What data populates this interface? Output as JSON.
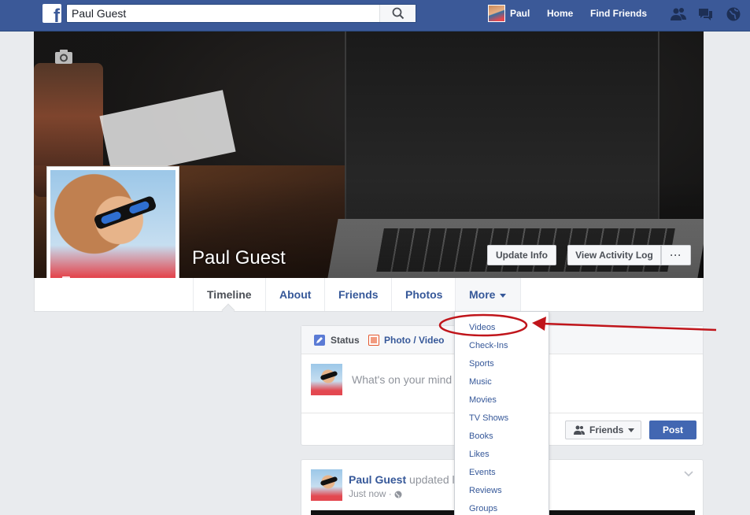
{
  "topbar": {
    "logo": "f",
    "search_value": "Paul Guest",
    "user_name": "Paul",
    "home": "Home",
    "find_friends": "Find Friends",
    "icons": [
      "friend-requests-icon",
      "messages-icon",
      "notifications-globe-icon"
    ]
  },
  "profile": {
    "name": "Paul Guest",
    "update_info": "Update Info",
    "view_activity_log": "View Activity Log",
    "more_dots": "···"
  },
  "tabs": {
    "timeline": "Timeline",
    "about": "About",
    "friends": "Friends",
    "photos": "Photos",
    "more": "More"
  },
  "more_menu": [
    "Videos",
    "Check-Ins",
    "Sports",
    "Music",
    "Movies",
    "TV Shows",
    "Books",
    "Likes",
    "Events",
    "Reviews",
    "Groups"
  ],
  "composer": {
    "status": "Status",
    "photo_video": "Photo / Video",
    "placeholder": "What's on your mind",
    "audience": "Friends",
    "post": "Post"
  },
  "feed_post": {
    "author": "Paul Guest",
    "action": "updated l",
    "time": "Just now ·"
  },
  "colors": {
    "brand": "#3b5998",
    "link": "#365899",
    "annotation": "#c0151b"
  }
}
